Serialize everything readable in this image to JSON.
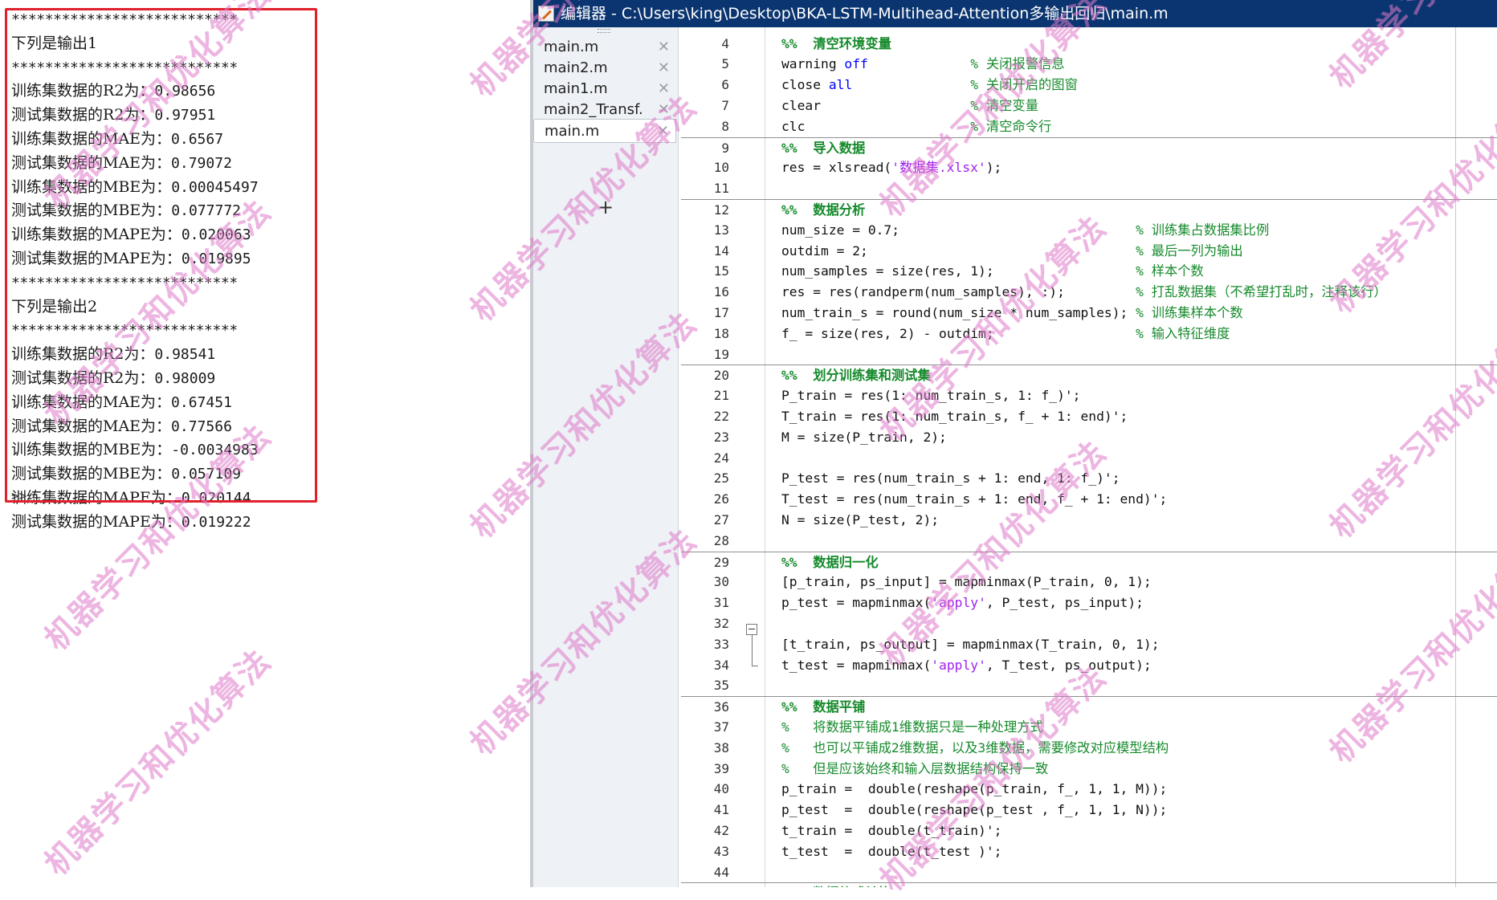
{
  "command_window": {
    "lines": [
      {
        "kind": "stars",
        "text": "***************************"
      },
      {
        "kind": "text",
        "text": "下列是输出1"
      },
      {
        "kind": "stars",
        "text": "***************************"
      },
      {
        "kind": "metric",
        "label": "训练集数据的R2为：",
        "value": "0.98656"
      },
      {
        "kind": "metric",
        "label": "测试集数据的R2为：",
        "value": "0.97951"
      },
      {
        "kind": "metric",
        "label": "训练集数据的MAE为：",
        "value": "0.6567"
      },
      {
        "kind": "metric",
        "label": "测试集数据的MAE为：",
        "value": "0.79072"
      },
      {
        "kind": "metric",
        "label": "训练集数据的MBE为：",
        "value": "0.00045497"
      },
      {
        "kind": "metric",
        "label": "测试集数据的MBE为：",
        "value": "0.077772"
      },
      {
        "kind": "metric",
        "label": "训练集数据的MAPE为：",
        "value": "0.020063"
      },
      {
        "kind": "metric",
        "label": "测试集数据的MAPE为：",
        "value": "0.019895"
      },
      {
        "kind": "stars",
        "text": "***************************"
      },
      {
        "kind": "text",
        "text": "下列是输出2"
      },
      {
        "kind": "stars",
        "text": "***************************"
      },
      {
        "kind": "metric",
        "label": "训练集数据的R2为：",
        "value": "0.98541"
      },
      {
        "kind": "metric",
        "label": "测试集数据的R2为：",
        "value": "0.98009"
      },
      {
        "kind": "metric",
        "label": "训练集数据的MAE为：",
        "value": "0.67451"
      },
      {
        "kind": "metric",
        "label": "测试集数据的MAE为：",
        "value": "0.77566"
      },
      {
        "kind": "metric",
        "label": "训练集数据的MBE为：",
        "value": "-0.0034983"
      },
      {
        "kind": "metric",
        "label": "测试集数据的MBE为：",
        "value": "0.057109"
      },
      {
        "kind": "metric",
        "label": "训练集数据的MAPE为：",
        "value": "0.020144"
      },
      {
        "kind": "metric",
        "label": "测试集数据的MAPE为：",
        "value": "0.019222"
      }
    ],
    "prompt": ">>",
    "highlight_color": "#e0202a"
  },
  "editor": {
    "title": "编辑器 - C:\\Users\\king\\Desktop\\BKA-LSTM-Multihead-Attention多输出回归\\main.m",
    "title_icon": "pencil-icon",
    "title_bar_color": "#0b3570",
    "tabs": [
      {
        "label": "main.m",
        "active": false
      },
      {
        "label": "main2.m",
        "active": false
      },
      {
        "label": "main1.m",
        "active": false
      },
      {
        "label": "main2_Transf...",
        "active": false
      },
      {
        "label": "main.m",
        "active": true
      }
    ],
    "close_glyph": "✕",
    "add_tab_glyph": "+",
    "code_lines": [
      {
        "n": "4",
        "sec": false,
        "segs": [
          [
            "cmt-b",
            "%%  清空环境变量"
          ]
        ]
      },
      {
        "n": "5",
        "sec": false,
        "segs": [
          [
            "",
            "warning "
          ],
          [
            "kw",
            "off"
          ],
          [
            "",
            "             "
          ],
          [
            "cmt",
            "% 关闭报警信息"
          ]
        ]
      },
      {
        "n": "6",
        "sec": false,
        "segs": [
          [
            "",
            "close "
          ],
          [
            "kw",
            "all"
          ],
          [
            "",
            "               "
          ],
          [
            "cmt",
            "% 关闭开启的图窗"
          ]
        ]
      },
      {
        "n": "7",
        "sec": false,
        "segs": [
          [
            "",
            "clear                   "
          ],
          [
            "cmt",
            "% 清空变量"
          ]
        ]
      },
      {
        "n": "8",
        "sec": false,
        "segs": [
          [
            "",
            "clc                     "
          ],
          [
            "cmt",
            "% 清空命令行"
          ]
        ]
      },
      {
        "n": "9",
        "sec": true,
        "segs": [
          [
            "cmt-b",
            "%%  导入数据"
          ]
        ]
      },
      {
        "n": "10",
        "sec": false,
        "segs": [
          [
            "",
            "res = xlsread("
          ],
          [
            "str",
            "'数据集.xlsx'"
          ],
          [
            "",
            ");"
          ]
        ]
      },
      {
        "n": "11",
        "sec": false,
        "segs": [
          [
            "",
            ""
          ]
        ]
      },
      {
        "n": "12",
        "sec": true,
        "segs": [
          [
            "cmt-b",
            "%%  数据分析"
          ]
        ]
      },
      {
        "n": "13",
        "sec": false,
        "segs": [
          [
            "",
            "num_size = 0.7;                              "
          ],
          [
            "cmt",
            "% 训练集占数据集比例"
          ]
        ]
      },
      {
        "n": "14",
        "sec": false,
        "segs": [
          [
            "",
            "outdim = 2;                                  "
          ],
          [
            "cmt",
            "% 最后一列为输出"
          ]
        ]
      },
      {
        "n": "15",
        "sec": false,
        "segs": [
          [
            "",
            "num_samples = size(res, 1);                  "
          ],
          [
            "cmt",
            "% 样本个数"
          ]
        ]
      },
      {
        "n": "16",
        "sec": false,
        "segs": [
          [
            "",
            "res = res(randperm(num_samples), :);         "
          ],
          [
            "cmt",
            "% 打乱数据集（不希望打乱时，注释该行）"
          ]
        ]
      },
      {
        "n": "17",
        "sec": false,
        "segs": [
          [
            "",
            "num_train_s = round(num_size * num_samples); "
          ],
          [
            "cmt",
            "% 训练集样本个数"
          ]
        ]
      },
      {
        "n": "18",
        "sec": false,
        "segs": [
          [
            "",
            "f_ = size(res, 2) - outdim;                  "
          ],
          [
            "cmt",
            "% 输入特征维度"
          ]
        ]
      },
      {
        "n": "19",
        "sec": false,
        "segs": [
          [
            "",
            ""
          ]
        ]
      },
      {
        "n": "20",
        "sec": true,
        "segs": [
          [
            "cmt-b",
            "%%  划分训练集和测试集"
          ]
        ]
      },
      {
        "n": "21",
        "sec": false,
        "segs": [
          [
            "",
            "P_train = res(1: num_train_s, 1: f_)';"
          ]
        ]
      },
      {
        "n": "22",
        "sec": false,
        "segs": [
          [
            "",
            "T_train = res(1: num_train_s, f_ + 1: end)';"
          ]
        ]
      },
      {
        "n": "23",
        "sec": false,
        "segs": [
          [
            "",
            "M = size(P_train, 2);"
          ]
        ]
      },
      {
        "n": "24",
        "sec": false,
        "segs": [
          [
            "",
            ""
          ]
        ]
      },
      {
        "n": "25",
        "sec": false,
        "segs": [
          [
            "",
            "P_test = res(num_train_s + 1: end, 1: f_)';"
          ]
        ]
      },
      {
        "n": "26",
        "sec": false,
        "segs": [
          [
            "",
            "T_test = res(num_train_s + 1: end, f_ + 1: end)';"
          ]
        ]
      },
      {
        "n": "27",
        "sec": false,
        "segs": [
          [
            "",
            "N = size(P_test, 2);"
          ]
        ]
      },
      {
        "n": "28",
        "sec": false,
        "segs": [
          [
            "",
            ""
          ]
        ]
      },
      {
        "n": "29",
        "sec": true,
        "segs": [
          [
            "cmt-b",
            "%%  数据归一化"
          ]
        ]
      },
      {
        "n": "30",
        "sec": false,
        "segs": [
          [
            "",
            "[p_train, ps_input] = mapminmax(P_train, 0, 1);"
          ]
        ]
      },
      {
        "n": "31",
        "sec": false,
        "segs": [
          [
            "",
            "p_test = mapminmax("
          ],
          [
            "str",
            "'apply'"
          ],
          [
            "",
            ", P_test, ps_input);"
          ]
        ]
      },
      {
        "n": "32",
        "sec": false,
        "segs": [
          [
            "",
            ""
          ]
        ]
      },
      {
        "n": "33",
        "sec": false,
        "segs": [
          [
            "",
            "[t_train, ps_output] = mapminmax(T_train, 0, 1);"
          ]
        ]
      },
      {
        "n": "34",
        "sec": false,
        "segs": [
          [
            "",
            "t_test = mapminmax("
          ],
          [
            "str",
            "'apply'"
          ],
          [
            "",
            ", T_test, ps_output);"
          ]
        ]
      },
      {
        "n": "35",
        "sec": false,
        "segs": [
          [
            "",
            ""
          ]
        ]
      },
      {
        "n": "36",
        "sec": true,
        "segs": [
          [
            "cmt-b",
            "%%  数据平铺"
          ]
        ]
      },
      {
        "n": "37",
        "sec": false,
        "segs": [
          [
            "cmt",
            "%   将数据平铺成1维数据只是一种处理方式"
          ]
        ]
      },
      {
        "n": "38",
        "sec": false,
        "segs": [
          [
            "cmt",
            "%   也可以平铺成2维数据，以及3维数据，需要修改对应模型结构"
          ]
        ]
      },
      {
        "n": "39",
        "sec": false,
        "segs": [
          [
            "cmt",
            "%   但是应该始终和输入层数据结构保持一致"
          ]
        ]
      },
      {
        "n": "40",
        "sec": false,
        "segs": [
          [
            "",
            "p_train =  double(reshape(p_train, f_, 1, 1, M));"
          ]
        ]
      },
      {
        "n": "41",
        "sec": false,
        "segs": [
          [
            "",
            "p_test  =  double(reshape(p_test , f_, 1, 1, N));"
          ]
        ]
      },
      {
        "n": "42",
        "sec": false,
        "segs": [
          [
            "",
            "t_train =  double(t_train)';"
          ]
        ]
      },
      {
        "n": "43",
        "sec": false,
        "segs": [
          [
            "",
            "t_test  =  double(t_test )';"
          ]
        ]
      },
      {
        "n": "44",
        "sec": false,
        "segs": [
          [
            "",
            ""
          ]
        ]
      },
      {
        "n": "45",
        "sec": true,
        "segs": [
          [
            "cmt-b",
            "%%  数据格式转换"
          ]
        ]
      }
    ]
  },
  "watermark": {
    "text": "机器学习和优化算法",
    "color": "rgba(222,120,200,0.55)"
  }
}
